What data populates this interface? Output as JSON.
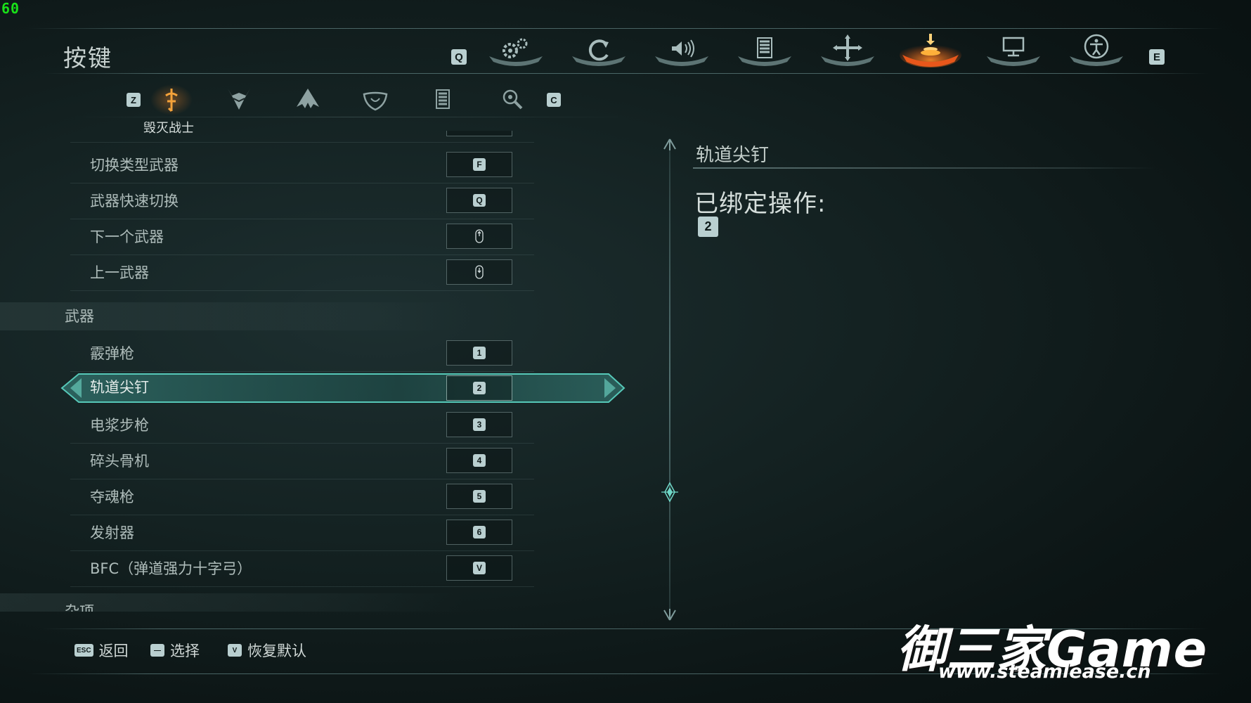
{
  "hud": {
    "fps": "60"
  },
  "header": {
    "title": "按键",
    "left_key": "Q",
    "right_key": "E",
    "tabs": [
      {
        "icon": "gears-icon",
        "active": false
      },
      {
        "icon": "refresh-icon",
        "active": false
      },
      {
        "icon": "speaker-icon",
        "active": false
      },
      {
        "icon": "list-icon",
        "active": false
      },
      {
        "icon": "crosshair-icon",
        "active": false
      },
      {
        "icon": "keybind-icon",
        "active": true
      },
      {
        "icon": "monitor-icon",
        "active": false
      },
      {
        "icon": "accessibility-icon",
        "active": false
      }
    ]
  },
  "subheader": {
    "left_key": "Z",
    "right_key": "C",
    "active_label": "毁灭战士",
    "tabs": [
      {
        "icon": "slayer-icon",
        "active": true
      },
      {
        "icon": "demon-helmet-icon",
        "active": false
      },
      {
        "icon": "wings-icon",
        "active": false
      },
      {
        "icon": "shield-icon",
        "active": false
      },
      {
        "icon": "list-icon",
        "active": false
      },
      {
        "icon": "eye-search-icon",
        "active": false
      }
    ]
  },
  "list": {
    "rows_top": [
      {
        "label": "切换类型武器",
        "key": "F",
        "kind": "key"
      },
      {
        "label": "武器快速切换",
        "key": "Q",
        "kind": "key"
      },
      {
        "label": "下一个武器",
        "key": "",
        "kind": "mouse-wheel-up"
      },
      {
        "label": "上一武器",
        "key": "",
        "kind": "mouse-wheel-down"
      }
    ],
    "section_weapons": "武器",
    "rows_weapons": [
      {
        "label": "霰弹枪",
        "key": "1",
        "kind": "key"
      },
      {
        "label": "轨道尖钉",
        "key": "2",
        "kind": "key",
        "selected": true
      },
      {
        "label": "电浆步枪",
        "key": "3",
        "kind": "key"
      },
      {
        "label": "碎头骨机",
        "key": "4",
        "kind": "key"
      },
      {
        "label": "夺魂枪",
        "key": "5",
        "kind": "key"
      },
      {
        "label": "发射器",
        "key": "6",
        "kind": "key"
      },
      {
        "label": "BFC（弹道强力十字弓）",
        "key": "V",
        "kind": "key"
      }
    ],
    "section_misc": "杂项"
  },
  "detail": {
    "title": "轨道尖钉",
    "bound_label": "已绑定操作:",
    "bound_key": "2"
  },
  "footer": {
    "back_key": "ESC",
    "back_label": "返回",
    "select_key": "—",
    "select_label": "选择",
    "reset_key": "V",
    "reset_label": "恢复默认"
  },
  "watermark": {
    "main": "御三家Game",
    "sub": "www.steamlease.cn"
  },
  "colors": {
    "accent_active": "#e8571b",
    "keycap": "#b9cfd0",
    "selection_glow": "#3fb7a8"
  }
}
